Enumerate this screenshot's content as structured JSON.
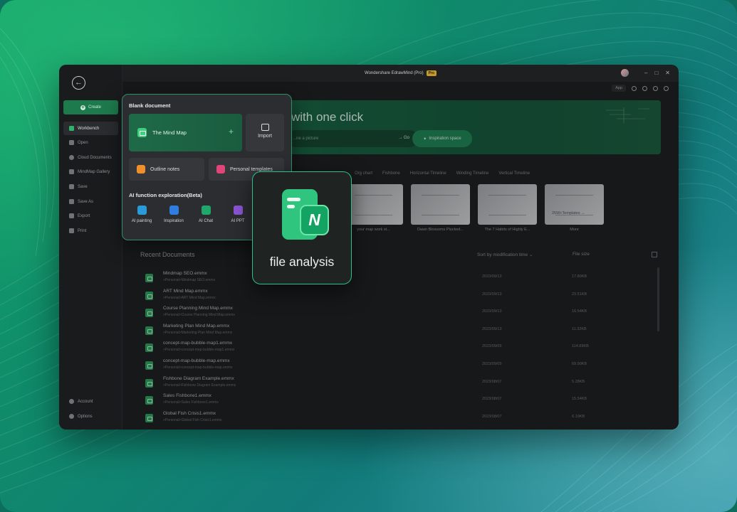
{
  "window": {
    "title": "Wondershare EdrawMind (Pro)",
    "pro_badge": "Pro"
  },
  "sidebar": {
    "create_label": "Create",
    "items": [
      {
        "label": "Workbench"
      },
      {
        "label": "Open"
      },
      {
        "label": "Cloud Documents"
      },
      {
        "label": "MindMap Gallery"
      },
      {
        "label": "Save"
      },
      {
        "label": "Save As"
      },
      {
        "label": "Export"
      },
      {
        "label": "Print"
      }
    ],
    "bottom_items": [
      {
        "label": "Account"
      },
      {
        "label": "Options"
      }
    ]
  },
  "toolbar": {
    "app_label": "App"
  },
  "banner": {
    "title": "with one click",
    "prompt_placeholder": "...ne a picture",
    "go_label": "→ Go",
    "inspiration_label": "Inspiration space"
  },
  "template_tabs": [
    "Org chart",
    "Fishbone",
    "Horizontal Timeline",
    "Winding Timeline",
    "Vertical Timeline"
  ],
  "templates": [
    {
      "caption": "your map work st..."
    },
    {
      "caption": "Dawn Blossoms Plucked..."
    },
    {
      "caption": "The 7 Habits of Highly E..."
    },
    {
      "caption": "More",
      "thumb_label": "25W+Templates  →"
    }
  ],
  "recent": {
    "title": "Recent Documents",
    "sort_label": "Sort by modification time ⌄",
    "size_label": "File size",
    "rows": [
      {
        "name": "Mindmap SEO.emmx",
        "path": ">Personal>Mindmap SEO.emmx",
        "date": "2023/09/13",
        "size": "17.80KB"
      },
      {
        "name": "ART Mind Map.emmx",
        "path": ">Personal>ART Mind Map.emmx",
        "date": "2023/09/13",
        "size": "23.51KB"
      },
      {
        "name": "Course Planning Mind Map.emmx",
        "path": ">Personal>Course Planning Mind Map.emmx",
        "date": "2023/09/13",
        "size": "16.54KB"
      },
      {
        "name": "Marketing Plan Mind Map.emmx",
        "path": ">Personal>Marketing Plan Mind Map.emmx",
        "date": "2023/09/13",
        "size": "11.32KB"
      },
      {
        "name": "concept-map-bubble-map1.emmx",
        "path": ">Personal>concept-map-bubble-map1.emmx",
        "date": "2023/09/05",
        "size": "114.89KB"
      },
      {
        "name": "concept-map-bubble-map.emmx",
        "path": ">Personal>concept-map-bubble-map.emmx",
        "date": "2023/09/05",
        "size": "69.90KB"
      },
      {
        "name": "Fishbone Diagram Example.emmx",
        "path": ">Personal>Fishbone Diagram Example.emmx",
        "date": "2023/08/07",
        "size": "5.28KB"
      },
      {
        "name": "Sales Fishbone1.emmx",
        "path": ">Personal>Sales Fishbone1.emmx",
        "date": "2023/08/07",
        "size": "15.54KB"
      },
      {
        "name": "Global Fish Crisis1.emmx",
        "path": ">Personal>Global Fish Crisis1.emmx",
        "date": "2023/08/07",
        "size": "6.19KB"
      }
    ]
  },
  "popup": {
    "blank_title": "Blank document",
    "mind_map_label": "The Mind Map",
    "import_label": "Import",
    "outline_label": "Outline notes",
    "personal_label": "Personal templates",
    "ai_title": "AI function exploration(Beta)",
    "ai_items": [
      {
        "label": "AI painting",
        "color": "#2a9ad8"
      },
      {
        "label": "Inspiration",
        "color": "#2f7de0"
      },
      {
        "label": "AI Chat",
        "color": "#1fa86a"
      },
      {
        "label": "AI PPT",
        "color": "#8b55d6"
      }
    ]
  },
  "file_analysis": {
    "label": "file analysis",
    "badge_letter": "N"
  },
  "colors": {
    "accent": "#2fb26b",
    "window_bg": "#1e1f21",
    "popup_border": "#2f8f6a"
  }
}
